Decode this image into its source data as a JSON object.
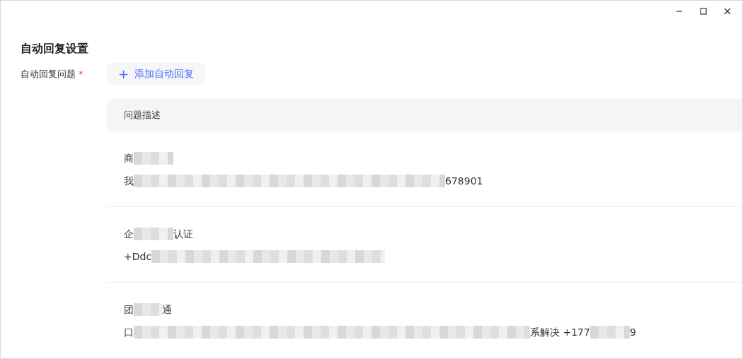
{
  "window": {
    "controls": [
      {
        "kind": "minimize"
      },
      {
        "kind": "maximize"
      },
      {
        "kind": "close"
      }
    ]
  },
  "heading": "自动回复设置",
  "field": {
    "label": "自动回复问题",
    "required": true,
    "required_mark": "*",
    "add_button": {
      "icon": "+",
      "label": "添加自动回复"
    }
  },
  "table": {
    "columns": [
      "问题描述"
    ],
    "rows": [
      {
        "title": [
          {
            "kind": "text",
            "text": "商"
          },
          {
            "kind": "smudge"
          }
        ],
        "body": [
          {
            "kind": "text",
            "text": "我"
          },
          {
            "kind": "band"
          },
          {
            "kind": "text",
            "text": "678901"
          }
        ]
      },
      {
        "title": [
          {
            "kind": "text",
            "text": "企"
          },
          {
            "kind": "smudge"
          },
          {
            "kind": "text",
            "text": "认证"
          }
        ],
        "body": [
          {
            "kind": "text",
            "text": "+Ddc"
          },
          {
            "kind": "strip"
          }
        ]
      },
      {
        "title": [
          {
            "kind": "text",
            "text": "团"
          },
          {
            "kind": "dab"
          },
          {
            "kind": "text",
            "text": "通"
          }
        ],
        "body": [
          {
            "kind": "text",
            "text": "口"
          },
          {
            "kind": "streak"
          },
          {
            "kind": "text",
            "text": "系解决 +177"
          },
          {
            "kind": "smudge"
          },
          {
            "kind": "text",
            "text": "9"
          }
        ]
      }
    ]
  }
}
